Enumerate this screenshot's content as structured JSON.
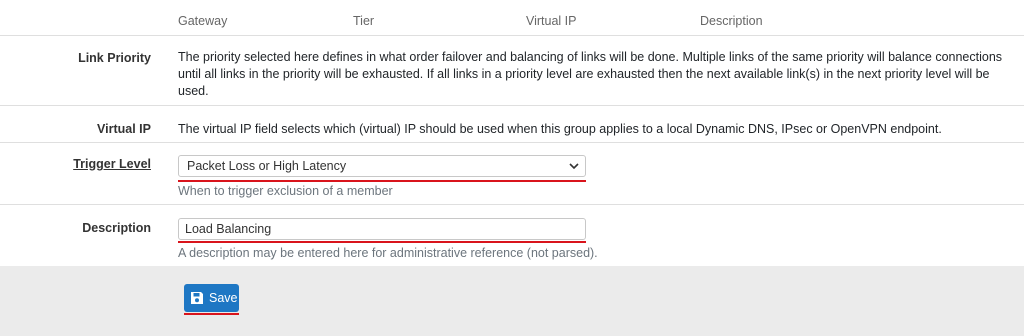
{
  "table_header": {
    "columns": [
      "Gateway",
      "Tier",
      "Virtual IP",
      "Description"
    ]
  },
  "link_priority": {
    "label": "Link Priority",
    "text": "The priority selected here defines in what order failover and balancing of links will be done. Multiple links of the same priority will balance connections until all links in the priority will be exhausted. If all links in a priority level are exhausted then the next available link(s) in the next priority level will be used."
  },
  "virtual_ip": {
    "label": "Virtual IP",
    "text": "The virtual IP field selects which (virtual) IP should be used when this group applies to a local Dynamic DNS, IPsec or OpenVPN endpoint."
  },
  "trigger_level": {
    "label": "Trigger Level",
    "selected": "Packet Loss or High Latency",
    "help": "When to trigger exclusion of a member"
  },
  "description": {
    "label": "Description",
    "value": "Load Balancing",
    "help": "A description may be entered here for administrative reference (not parsed)."
  },
  "save_button": {
    "label": "Save",
    "icon": "save-icon"
  },
  "colors": {
    "accent": "#1e77c4",
    "highlight": "#d9141c"
  }
}
